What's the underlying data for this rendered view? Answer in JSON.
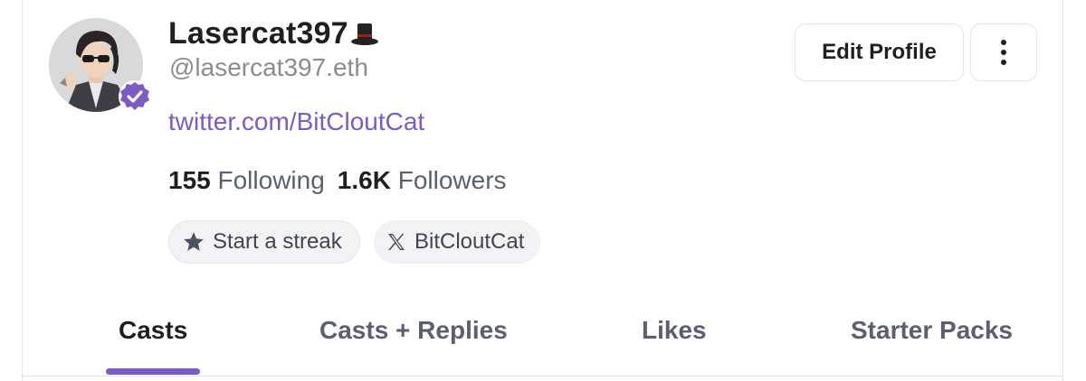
{
  "profile": {
    "name": "Lasercat397",
    "handle": "@lasercat397.eth",
    "link": "twitter.com/BitCloutCat",
    "following_count": "155",
    "following_label": "Following",
    "followers_count": "1.6K",
    "followers_label": "Followers",
    "name_emoji_icon": "top-hat-icon",
    "verified_icon": "verified-badge-icon"
  },
  "chips": {
    "streak_label": "Start a streak",
    "streak_icon": "star-icon",
    "x_label": "BitCloutCat",
    "x_icon": "x-logo-icon"
  },
  "actions": {
    "edit_label": "Edit Profile",
    "more_icon": "vertical-ellipsis-icon"
  },
  "tabs": [
    {
      "label": "Casts",
      "active": true
    },
    {
      "label": "Casts + Replies",
      "active": false
    },
    {
      "label": "Likes",
      "active": false
    },
    {
      "label": "Starter Packs",
      "active": false
    }
  ],
  "colors": {
    "accent": "#7c5cc4",
    "text": "#1f1f23",
    "muted": "#8b8b94"
  }
}
